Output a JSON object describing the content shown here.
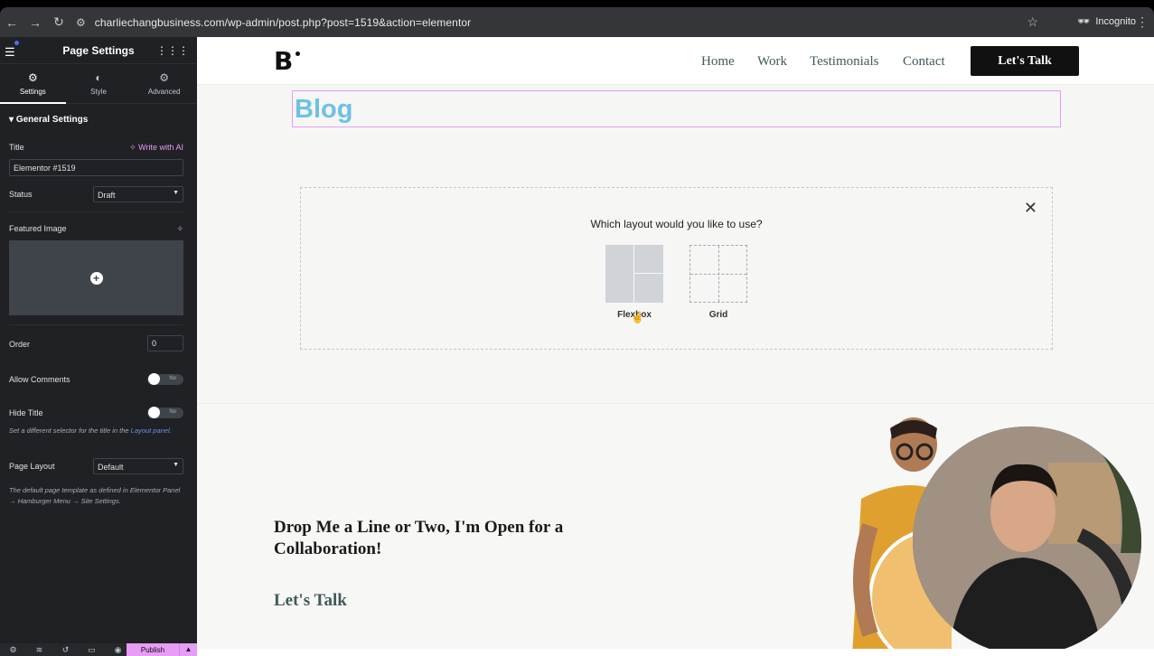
{
  "browser": {
    "url": "charliechangbusiness.com/wp-admin/post.php?post=1519&action=elementor",
    "incognito_label": "Incognito",
    "icons": [
      "back-arrow-icon",
      "forward-arrow-icon",
      "reload-icon",
      "site-settings-icon",
      "star-icon",
      "incognito-icon",
      "kebab-menu-icon"
    ]
  },
  "panel": {
    "title": "Page Settings",
    "tabs": [
      {
        "label": "Settings",
        "icon": "gear-icon"
      },
      {
        "label": "Style",
        "icon": "half-circle-icon"
      },
      {
        "label": "Advanced",
        "icon": "cog-icon"
      }
    ],
    "section_title": "General Settings",
    "title_label": "Title",
    "write_with_ai": "Write with AI",
    "title_value": "Elementor #1519",
    "status_label": "Status",
    "status_value": "Draft",
    "featured_image_label": "Featured Image",
    "order_label": "Order",
    "order_value": "0",
    "allow_comments_label": "Allow Comments",
    "allow_comments_toggle": "No",
    "hide_title_label": "Hide Title",
    "hide_title_toggle": "No",
    "hide_title_help_pre": "Set a different selector for the title in the",
    "hide_title_help_link": "Layout panel",
    "page_layout_label": "Page Layout",
    "page_layout_value": "Default",
    "page_layout_help": "The default page template as defined in Elementor Panel → Hamburger Menu → Site Settings.",
    "publish_label": "Publish",
    "accent": "#e79cf6"
  },
  "site": {
    "logo": "B",
    "nav": [
      "Home",
      "Work",
      "Testimonials",
      "Contact"
    ],
    "cta_button": "Let's Talk",
    "blog_title": "Blog",
    "layout_question": "Which layout would you like to use?",
    "layout_options": [
      "Flexbox",
      "Grid"
    ],
    "footer_heading": "Drop Me a Line or Two, I'm Open for a Collaboration!",
    "footer_link": "Let's Talk"
  }
}
